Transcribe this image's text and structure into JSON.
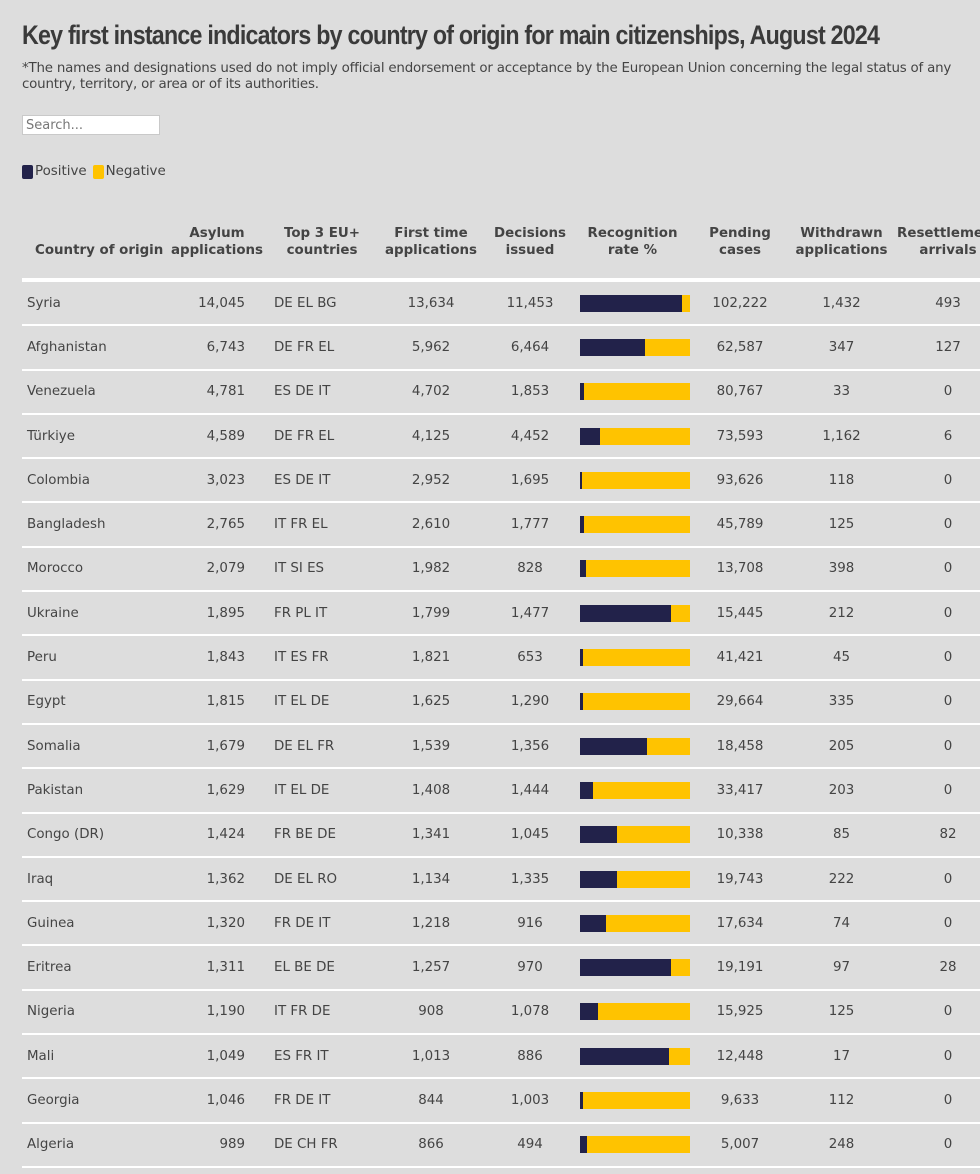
{
  "title": "Key first instance indicators by country of origin for main citizenships, August 2024",
  "note": "*The names and designations used do not imply official endorsement or acceptance by the European Union concerning the legal status of any country, territory, or area or of its authorities.",
  "search": {
    "placeholder": "Search...",
    "value": ""
  },
  "legend": {
    "positive": {
      "label": "Positive",
      "color": "#22224a"
    },
    "negative": {
      "label": "Negative",
      "color": "#ffc300"
    }
  },
  "columns": {
    "country": "Country of origin",
    "asylum_1": "Asylum",
    "asylum_2": "applications",
    "top3_1": "Top 3 EU+",
    "top3_2": "countries",
    "first_1": "First time",
    "first_2": "applications",
    "decisions_1": "Decisions",
    "decisions_2": "issued",
    "recog_1": "Recognition",
    "recog_2": "rate %",
    "pending_1": "Pending",
    "pending_2": "cases",
    "withdrawn_1": "Withdrawn",
    "withdrawn_2": "applications",
    "resettle_1": "Resettlement",
    "resettle_2": "arrivals"
  },
  "chart_data": {
    "type": "table",
    "title": "Key first instance indicators by country of origin for main citizenships, August 2024",
    "legend": [
      "Positive",
      "Negative"
    ],
    "recognition_rate_type": "stacked-bar (positive share vs negative share, percent)",
    "rows": [
      {
        "country": "Syria",
        "asylum": "14,045",
        "top3": "DE EL BG",
        "first_time": "13,634",
        "decisions": "11,453",
        "recognition_rate": 93,
        "pending": "102,222",
        "withdrawn": "1,432",
        "resettlement": "493"
      },
      {
        "country": "Afghanistan",
        "asylum": "6,743",
        "top3": "DE FR EL",
        "first_time": "5,962",
        "decisions": "6,464",
        "recognition_rate": 59,
        "pending": "62,587",
        "withdrawn": "347",
        "resettlement": "127"
      },
      {
        "country": "Venezuela",
        "asylum": "4,781",
        "top3": "ES DE IT",
        "first_time": "4,702",
        "decisions": "1,853",
        "recognition_rate": 4,
        "pending": "80,767",
        "withdrawn": "33",
        "resettlement": "0"
      },
      {
        "country": "Türkiye",
        "asylum": "4,589",
        "top3": "DE FR EL",
        "first_time": "4,125",
        "decisions": "4,452",
        "recognition_rate": 18,
        "pending": "73,593",
        "withdrawn": "1,162",
        "resettlement": "6"
      },
      {
        "country": "Colombia",
        "asylum": "3,023",
        "top3": "ES DE IT",
        "first_time": "2,952",
        "decisions": "1,695",
        "recognition_rate": 2,
        "pending": "93,626",
        "withdrawn": "118",
        "resettlement": "0"
      },
      {
        "country": "Bangladesh",
        "asylum": "2,765",
        "top3": "IT FR EL",
        "first_time": "2,610",
        "decisions": "1,777",
        "recognition_rate": 4,
        "pending": "45,789",
        "withdrawn": "125",
        "resettlement": "0"
      },
      {
        "country": "Morocco",
        "asylum": "2,079",
        "top3": "IT SI ES",
        "first_time": "1,982",
        "decisions": "828",
        "recognition_rate": 5,
        "pending": "13,708",
        "withdrawn": "398",
        "resettlement": "0"
      },
      {
        "country": "Ukraine",
        "asylum": "1,895",
        "top3": "FR PL IT",
        "first_time": "1,799",
        "decisions": "1,477",
        "recognition_rate": 83,
        "pending": "15,445",
        "withdrawn": "212",
        "resettlement": "0"
      },
      {
        "country": "Peru",
        "asylum": "1,843",
        "top3": "IT ES FR",
        "first_time": "1,821",
        "decisions": "653",
        "recognition_rate": 3,
        "pending": "41,421",
        "withdrawn": "45",
        "resettlement": "0"
      },
      {
        "country": "Egypt",
        "asylum": "1,815",
        "top3": "IT EL DE",
        "first_time": "1,625",
        "decisions": "1,290",
        "recognition_rate": 3,
        "pending": "29,664",
        "withdrawn": "335",
        "resettlement": "0"
      },
      {
        "country": "Somalia",
        "asylum": "1,679",
        "top3": "DE EL FR",
        "first_time": "1,539",
        "decisions": "1,356",
        "recognition_rate": 61,
        "pending": "18,458",
        "withdrawn": "205",
        "resettlement": "0"
      },
      {
        "country": "Pakistan",
        "asylum": "1,629",
        "top3": "IT EL DE",
        "first_time": "1,408",
        "decisions": "1,444",
        "recognition_rate": 12,
        "pending": "33,417",
        "withdrawn": "203",
        "resettlement": "0"
      },
      {
        "country": "Congo (DR)",
        "asylum": "1,424",
        "top3": "FR BE DE",
        "first_time": "1,341",
        "decisions": "1,045",
        "recognition_rate": 34,
        "pending": "10,338",
        "withdrawn": "85",
        "resettlement": "82"
      },
      {
        "country": "Iraq",
        "asylum": "1,362",
        "top3": "DE EL RO",
        "first_time": "1,134",
        "decisions": "1,335",
        "recognition_rate": 34,
        "pending": "19,743",
        "withdrawn": "222",
        "resettlement": "0"
      },
      {
        "country": "Guinea",
        "asylum": "1,320",
        "top3": "FR DE IT",
        "first_time": "1,218",
        "decisions": "916",
        "recognition_rate": 24,
        "pending": "17,634",
        "withdrawn": "74",
        "resettlement": "0"
      },
      {
        "country": "Eritrea",
        "asylum": "1,311",
        "top3": "EL BE DE",
        "first_time": "1,257",
        "decisions": "970",
        "recognition_rate": 83,
        "pending": "19,191",
        "withdrawn": "97",
        "resettlement": "28"
      },
      {
        "country": "Nigeria",
        "asylum": "1,190",
        "top3": "IT FR DE",
        "first_time": "908",
        "decisions": "1,078",
        "recognition_rate": 16,
        "pending": "15,925",
        "withdrawn": "125",
        "resettlement": "0"
      },
      {
        "country": "Mali",
        "asylum": "1,049",
        "top3": "ES FR IT",
        "first_time": "1,013",
        "decisions": "886",
        "recognition_rate": 81,
        "pending": "12,448",
        "withdrawn": "17",
        "resettlement": "0"
      },
      {
        "country": "Georgia",
        "asylum": "1,046",
        "top3": "FR DE IT",
        "first_time": "844",
        "decisions": "1,003",
        "recognition_rate": 3,
        "pending": "9,633",
        "withdrawn": "112",
        "resettlement": "0"
      },
      {
        "country": "Algeria",
        "asylum": "989",
        "top3": "DE CH FR",
        "first_time": "866",
        "decisions": "494",
        "recognition_rate": 6,
        "pending": "5,007",
        "withdrawn": "248",
        "resettlement": "0"
      }
    ]
  }
}
